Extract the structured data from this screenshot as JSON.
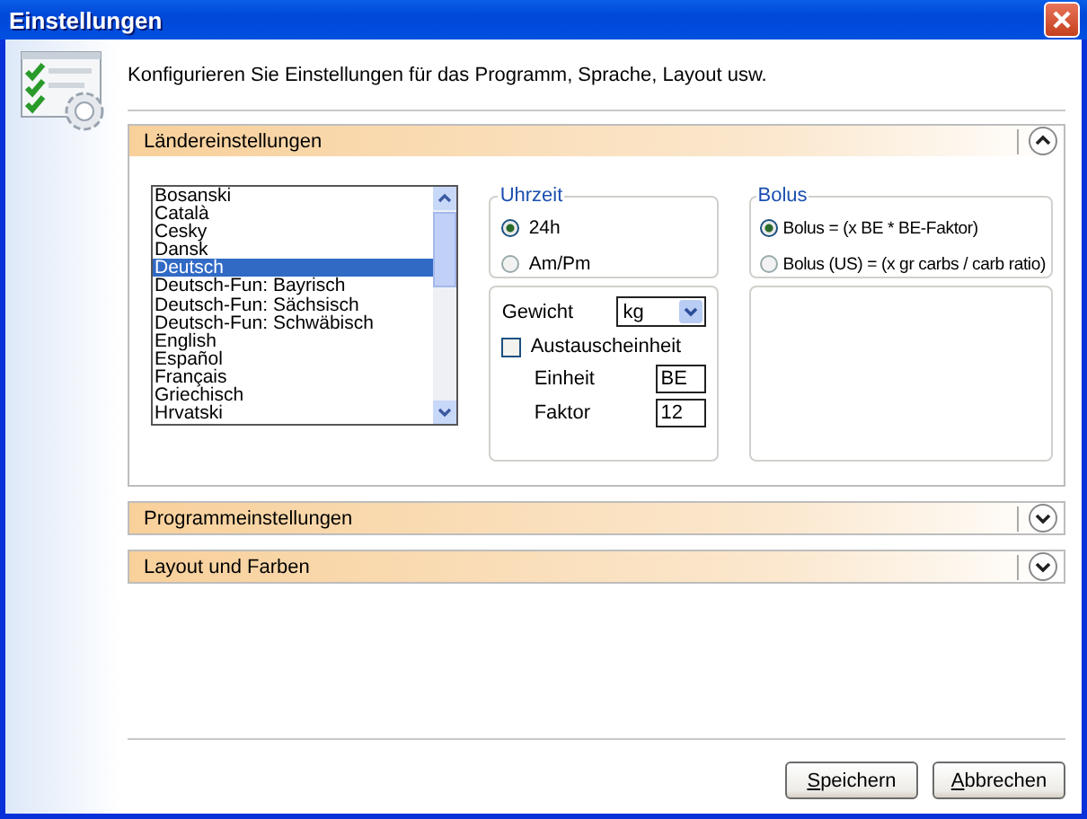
{
  "window": {
    "title": "Einstellungen"
  },
  "header": {
    "text": "Konfigurieren Sie Einstellungen für das Programm, Sprache, Layout usw."
  },
  "sections": [
    {
      "title": "Ländereinstellungen",
      "expanded": true
    },
    {
      "title": "Programmeinstellungen",
      "expanded": false
    },
    {
      "title": "Layout und Farben",
      "expanded": false
    }
  ],
  "languages": [
    {
      "label": "Bosanski",
      "selected": false
    },
    {
      "label": "Català",
      "selected": false
    },
    {
      "label": "Cesky",
      "selected": false
    },
    {
      "label": "Dansk",
      "selected": false
    },
    {
      "label": "Deutsch",
      "selected": true
    },
    {
      "label": "Deutsch-Fun: Bayrisch",
      "selected": false
    },
    {
      "label": "Deutsch-Fun: Sächsisch",
      "selected": false
    },
    {
      "label": "Deutsch-Fun: Schwäbisch",
      "selected": false
    },
    {
      "label": "English",
      "selected": false
    },
    {
      "label": "Español",
      "selected": false
    },
    {
      "label": "Français",
      "selected": false
    },
    {
      "label": "Griechisch",
      "selected": false
    },
    {
      "label": "Hrvatski",
      "selected": false
    }
  ],
  "time": {
    "title": "Uhrzeit",
    "options": [
      {
        "label": "24h",
        "selected": true
      },
      {
        "label": "Am/Pm",
        "selected": false
      }
    ]
  },
  "weight": {
    "label": "Gewicht",
    "value": "kg"
  },
  "exchange": {
    "label": "Austauscheinheit",
    "checked": false,
    "fields": [
      {
        "label": "Einheit",
        "value": "BE"
      },
      {
        "label": "Faktor",
        "value": "12"
      }
    ]
  },
  "bolus": {
    "title": "Bolus",
    "options": [
      {
        "label": "Bolus = (x BE * BE-Faktor)",
        "selected": true
      },
      {
        "label": "Bolus (US) = (x gr carbs / carb ratio)",
        "selected": false
      }
    ]
  },
  "buttons": [
    {
      "label": "Speichern"
    },
    {
      "label": "Abbrechen"
    }
  ]
}
